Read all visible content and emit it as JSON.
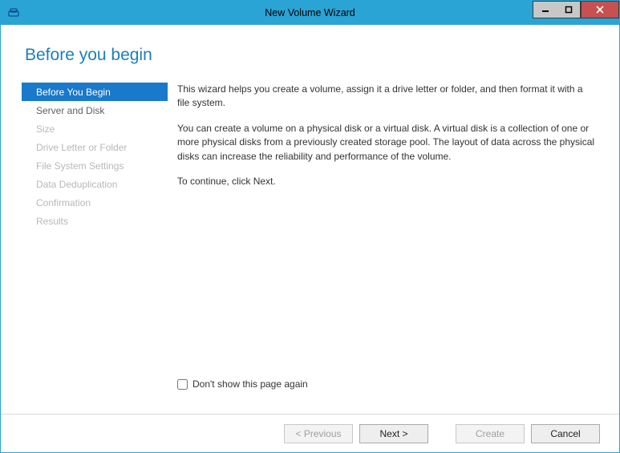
{
  "window": {
    "title": "New Volume Wizard"
  },
  "page": {
    "heading": "Before you begin"
  },
  "sidebar": {
    "items": [
      {
        "label": "Before You Begin",
        "state": "active"
      },
      {
        "label": "Server and Disk",
        "state": "enabled"
      },
      {
        "label": "Size",
        "state": "disabled"
      },
      {
        "label": "Drive Letter or Folder",
        "state": "disabled"
      },
      {
        "label": "File System Settings",
        "state": "disabled"
      },
      {
        "label": "Data Deduplication",
        "state": "disabled"
      },
      {
        "label": "Confirmation",
        "state": "disabled"
      },
      {
        "label": "Results",
        "state": "disabled"
      }
    ]
  },
  "main": {
    "p1": "This wizard helps you create a volume, assign it a drive letter or folder, and then format it with a file system.",
    "p2": "You can create a volume on a physical disk or a virtual disk. A virtual disk is a collection of one or more physical disks from a previously created storage pool. The layout of data across the physical disks can increase the reliability and performance of the volume.",
    "p3": "To continue, click Next.",
    "checkbox_label": "Don't show this page again"
  },
  "footer": {
    "previous": "< Previous",
    "next": "Next >",
    "create": "Create",
    "cancel": "Cancel"
  }
}
